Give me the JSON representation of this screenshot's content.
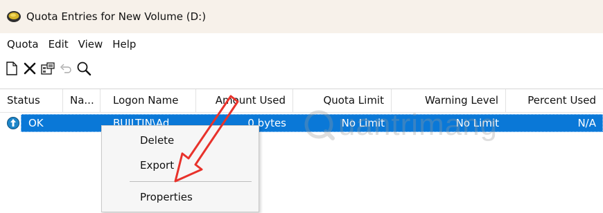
{
  "window": {
    "title": "Quota Entries for New Volume (D:)",
    "icon": "drive-icon"
  },
  "menu": [
    "Quota",
    "Edit",
    "View",
    "Help"
  ],
  "toolbar": {
    "buttons": [
      "new-entry-icon",
      "delete-icon",
      "properties-icon",
      "undo-icon",
      "find-icon"
    ]
  },
  "table": {
    "columns": [
      "Status",
      "Na...",
      "Logon Name",
      "Amount Used",
      "Quota Limit",
      "Warning Level",
      "Percent Used"
    ],
    "rows": [
      {
        "status": "OK",
        "name": "",
        "logon_name": "BUILTIN\\Ad...",
        "amount_used": "0 bytes",
        "quota_limit": "No Limit",
        "warning_level": "No Limit",
        "percent_used": "N/A"
      }
    ]
  },
  "context_menu": {
    "items": [
      "Delete",
      "Export",
      "Properties"
    ]
  },
  "watermark": {
    "text": "uantrimang"
  },
  "colors": {
    "selection": "#0a78d7",
    "titlebar": "#f7f1ea",
    "annotation_arrow": "#e8322b"
  }
}
